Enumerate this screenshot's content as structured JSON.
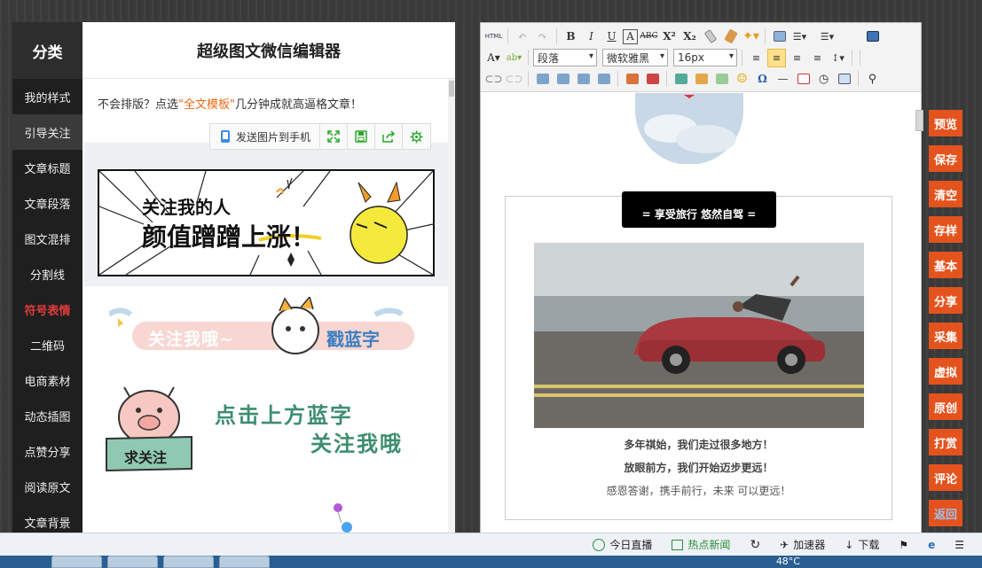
{
  "sidebar": {
    "title": "分类",
    "items": [
      {
        "label": "我的样式"
      },
      {
        "label": "引导关注"
      },
      {
        "label": "文章标题"
      },
      {
        "label": "文章段落"
      },
      {
        "label": "图文混排"
      },
      {
        "label": "分割线"
      },
      {
        "label": "符号表情"
      },
      {
        "label": "二维码"
      },
      {
        "label": "电商素材"
      },
      {
        "label": "动态插图"
      },
      {
        "label": "点赞分享"
      },
      {
        "label": "阅读原文"
      },
      {
        "label": "文章背景"
      }
    ],
    "active_index": 1,
    "highlight_index": 6
  },
  "templates": {
    "title": "超级图文微信编辑器",
    "tip_prefix": "不会排版？点选",
    "tip_link": "\"全文模板\"",
    "tip_suffix": "几分钟成就高逼格文章！",
    "send_label": "发送图片到手机",
    "banner1_line1": "关注我的人",
    "banner1_line2": "颜值蹭蹭上涨！",
    "banner2_left": "关注我哦~",
    "banner2_right": "戳蓝字",
    "banner3_badge": "求关注",
    "banner3_line1": "点击上方蓝字",
    "banner3_line2": "关注我哦"
  },
  "editor": {
    "toolbar": {
      "html_label": "HTML",
      "paragraph": "段落",
      "font": "微软雅黑",
      "size": "16px"
    },
    "article": {
      "tag": "= 享受旅行 悠然自驾 =",
      "line1": "多年祺始，我们走过很多地方！",
      "line2": "放眼前方，我们开始迈步更远！",
      "line3": "感恩答谢，携手前行，未来 可以更远！"
    }
  },
  "actions": [
    {
      "label": "预览"
    },
    {
      "label": "保存"
    },
    {
      "label": "清空"
    },
    {
      "label": "存样"
    },
    {
      "label": "基本"
    },
    {
      "label": "分享"
    },
    {
      "label": "采集"
    },
    {
      "label": "虚拟"
    },
    {
      "label": "原创"
    },
    {
      "label": "打赏"
    },
    {
      "label": "评论"
    },
    {
      "label": "返回"
    }
  ],
  "statusbar": {
    "live": "今日直播",
    "news": "热点新闻",
    "accelerator": "加速器",
    "download": "下载",
    "temp": "48°C"
  },
  "colors": {
    "accent": "#e4531d",
    "rail_bg": "#1f1f1f",
    "highlight_text": "#e23b3b",
    "link": "#e86a17"
  }
}
